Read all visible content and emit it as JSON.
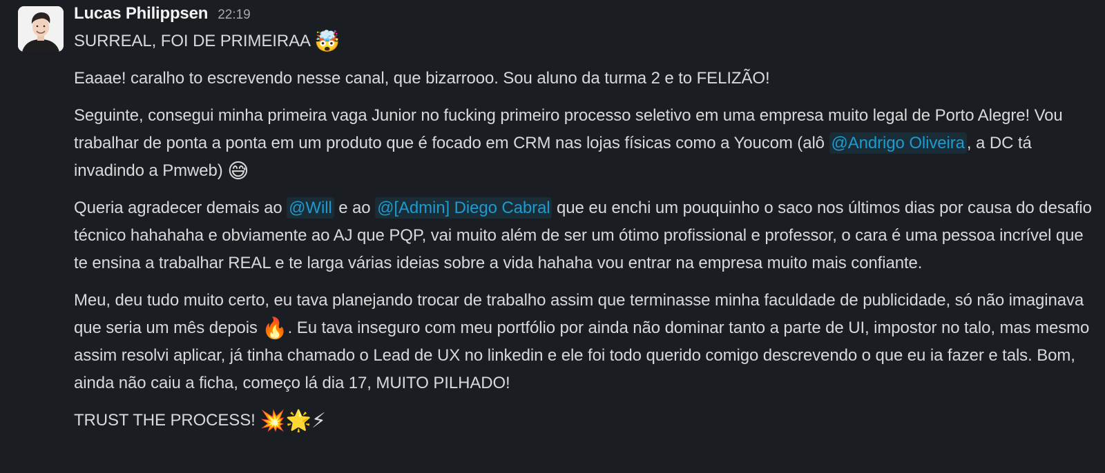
{
  "message": {
    "author": "Lucas Philippsen",
    "timestamp": "22:19",
    "p1": {
      "text": "SURREAL, FOI DE PRIMEIRAA",
      "emoji": "🤯"
    },
    "p2": "Eaaae! caralho to escrevendo nesse canal, que bizarrooo. Sou aluno da turma 2 e to FELIZÃO!",
    "p3": {
      "text_before": "Seguinte, consegui minha primeira vaga Junior no fucking primeiro processo seletivo em uma empresa muito legal de Porto Alegre! Vou trabalhar de ponta a ponta em um produto que é focado em CRM nas lojas físicas como a Youcom (alô ",
      "mention": "@Andrigo Oliveira",
      "text_after": ", a DC tá invadindo a Pmweb)",
      "emoji": "😅"
    },
    "p4": {
      "text_before": "Queria agradecer demais ao ",
      "mention_1": "@Will",
      "text_middle": " e ao ",
      "mention_2": "@[Admin] Diego Cabral",
      "text_after": " que eu enchi um pouquinho o saco nos últimos dias por causa do desafio técnico hahahaha e obviamente ao AJ que PQP, vai muito além de ser um ótimo profissional e professor, o cara é uma pessoa incrível que te ensina a trabalhar REAL e te larga várias ideias sobre a vida hahaha vou entrar na empresa muito mais confiante."
    },
    "p5": {
      "text_before": "Meu, deu tudo muito certo, eu tava planejando trocar de trabalho assim que terminasse minha faculdade de publicidade, só não imaginava que seria um mês depois ",
      "emoji": "🔥",
      "text_after": ". Eu tava inseguro com meu portfólio por ainda não dominar tanto a parte de UI, impostor no talo, mas mesmo assim resolvi aplicar, já tinha chamado o Lead de UX no linkedin e ele foi todo querido comigo descrevendo o que eu ia fazer e tals. Bom, ainda não caiu a ficha, começo lá dia 17, MUITO PILHADO!"
    },
    "p6": {
      "text": "TRUST THE PROCESS!",
      "emoji_1": "💥",
      "emoji_2": "🌟",
      "emoji_3": "⚡"
    }
  },
  "colors": {
    "background": "#1a1d21",
    "text": "#d8d9da",
    "mention": "#1d9bd1",
    "timestamp": "#a8a9ab"
  }
}
